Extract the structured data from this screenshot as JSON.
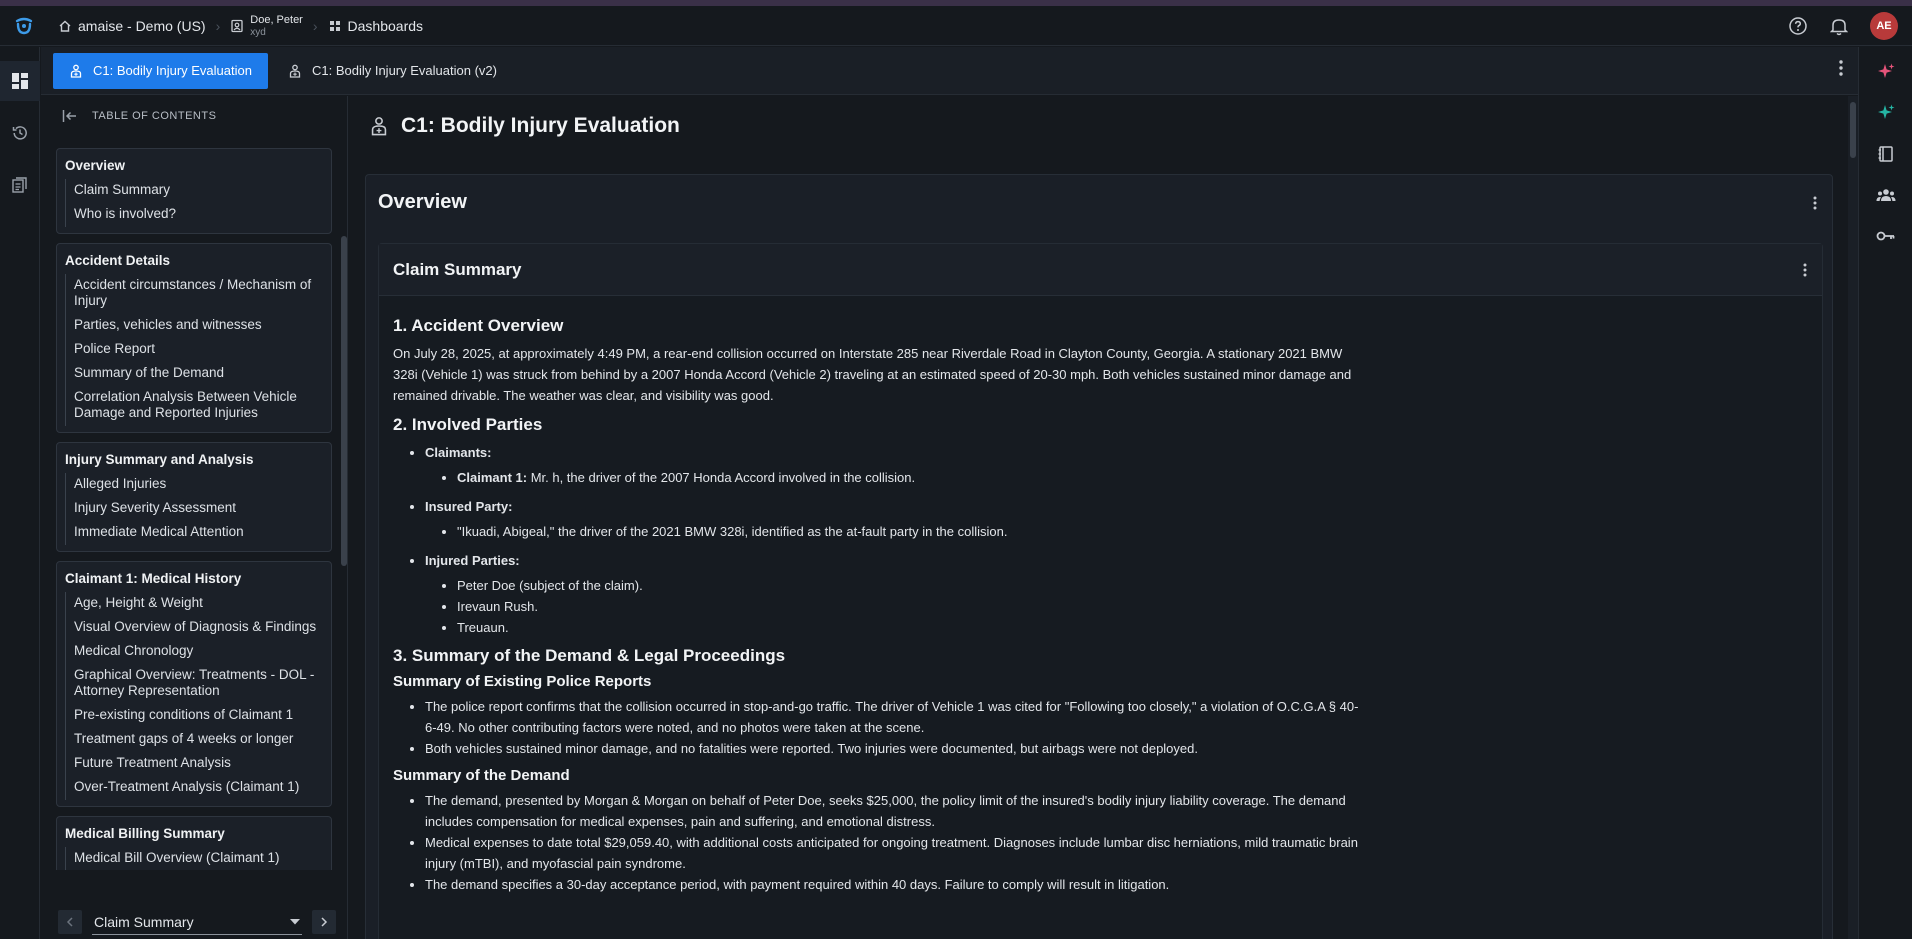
{
  "breadcrumbs": {
    "org": "amaise - Demo (US)",
    "person_name": "Doe, Peter",
    "person_sub": "xyd",
    "dashboards": "Dashboards"
  },
  "user": {
    "initials": "AE"
  },
  "tabs": [
    {
      "label": "C1: Bodily Injury Evaluation",
      "active": true
    },
    {
      "label": "C1: Bodily Injury Evaluation (v2)",
      "active": false
    }
  ],
  "toc": {
    "header": "TABLE OF CONTENTS",
    "groups": [
      {
        "title": "Overview",
        "items": [
          "Claim Summary",
          "Who is involved?"
        ]
      },
      {
        "title": "Accident Details",
        "items": [
          "Accident circumstances / Mechanism of Injury",
          "Parties, vehicles and witnesses",
          "Police Report",
          "Summary of the Demand",
          "Correlation Analysis Between Vehicle Damage and Reported Injuries"
        ]
      },
      {
        "title": "Injury Summary and Analysis",
        "items": [
          "Alleged Injuries",
          "Injury Severity Assessment",
          "Immediate Medical Attention"
        ]
      },
      {
        "title": "Claimant 1: Medical History",
        "items": [
          "Age, Height & Weight",
          "Visual Overview of Diagnosis & Findings",
          "Medical Chronology",
          "Graphical Overview: Treatments - DOL - Attorney Representation",
          "Pre-existing conditions of Claimant 1",
          "Treatment gaps of 4 weeks or longer",
          "Future Treatment Analysis",
          "Over-Treatment Analysis (Claimant 1)"
        ]
      },
      {
        "title": "Medical Billing Summary",
        "items": [
          "Medical Bill Overview (Claimant 1)"
        ]
      }
    ],
    "current_section": "Claim Summary"
  },
  "page": {
    "title": "C1: Bodily Injury Evaluation",
    "card_title": "Overview",
    "inner_title": "Claim Summary"
  },
  "content": {
    "s1_title": "1. Accident Overview",
    "s1_text": "On July 28, 2025, at approximately 4:49 PM, a rear-end collision occurred on Interstate 285 near Riverdale Road in Clayton County, Georgia. A stationary 2021 BMW 328i (Vehicle 1) was struck from behind by a 2007 Honda Accord (Vehicle 2) traveling at an estimated speed of 20-30 mph. Both vehicles sustained minor damage and remained drivable. The weather was clear, and visibility was good.",
    "s2_title": "2. Involved Parties",
    "claimants_label": "Claimants:",
    "claimant1_label": "Claimant 1:",
    "claimant1_text": " Mr. h, the driver of the 2007 Honda Accord involved in the collision.",
    "insured_label": "Insured Party:",
    "insured_text": "\"Ikuadi, Abigeal,\" the driver of the 2021 BMW 328i, identified as the at-fault party in the collision.",
    "injured_label": "Injured Parties:",
    "injured_list": [
      "Peter Doe (subject of the claim).",
      "Irevaun Rush.",
      "Treuaun."
    ],
    "s3_title": "3. Summary of the Demand & Legal Proceedings",
    "police_title": "Summary of Existing Police Reports",
    "police_list": [
      "The police report confirms that the collision occurred in stop-and-go traffic. The driver of Vehicle 1 was cited for \"Following too closely,\" a violation of O.C.G.A § 40-6-49. No other contributing factors were noted, and no photos were taken at the scene.",
      "Both vehicles sustained minor damage, and no fatalities were reported. Two injuries were documented, but airbags were not deployed."
    ],
    "demand_title": "Summary of the Demand",
    "demand_list": [
      "The demand, presented by Morgan & Morgan on behalf of Peter Doe, seeks $25,000, the policy limit of the insured's bodily injury liability coverage. The demand includes compensation for medical expenses, pain and suffering, and emotional distress.",
      "Medical expenses to date total $29,059.40, with additional costs anticipated for ongoing treatment. Diagnoses include lumbar disc herniations, mild traumatic brain injury (mTBI), and myofascial pain syndrome.",
      "The demand specifies a 30-day acceptance period, with payment required within 40 days. Failure to comply will result in litigation."
    ]
  }
}
